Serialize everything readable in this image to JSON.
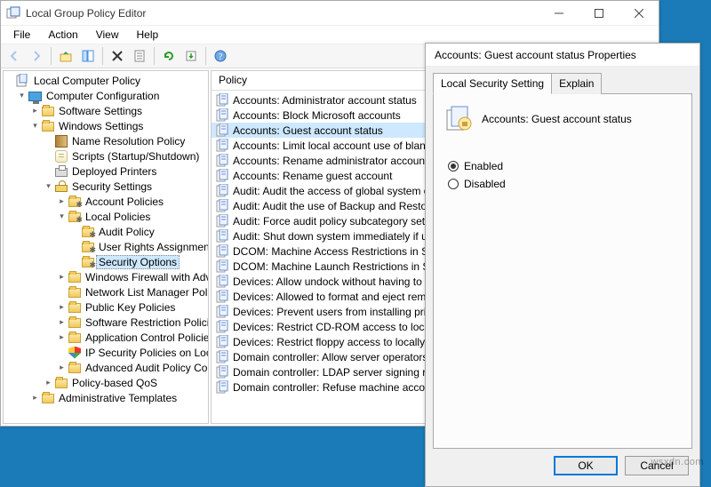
{
  "window": {
    "title": "Local Group Policy Editor"
  },
  "menubar": [
    "File",
    "Action",
    "View",
    "Help"
  ],
  "tree": {
    "root": "Local Computer Policy",
    "cc": "Computer Configuration",
    "ss": "Software Settings",
    "ws": "Windows Settings",
    "nrp": "Name Resolution Policy",
    "sss": "Scripts (Startup/Shutdown)",
    "dp": "Deployed Printers",
    "sec": "Security Settings",
    "ap": "Account Policies",
    "lp": "Local Policies",
    "audit": "Audit Policy",
    "ura": "User Rights Assignment",
    "so": "Security Options",
    "wfwa": "Windows Firewall with Advanced Security",
    "nlmp": "Network List Manager Policies",
    "pkp": "Public Key Policies",
    "srp": "Software Restriction Policies",
    "acp": "Application Control Policies",
    "ipsec": "IP Security Policies on Local Computer",
    "aap": "Advanced Audit Policy Configuration",
    "pqos": "Policy-based QoS",
    "at": "Administrative Templates"
  },
  "list": {
    "header": "Policy",
    "items": [
      "Accounts: Administrator account status",
      "Accounts: Block Microsoft accounts",
      "Accounts: Guest account status",
      "Accounts: Limit local account use of blank passwords to console logon only",
      "Accounts: Rename administrator account",
      "Accounts: Rename guest account",
      "Audit: Audit the access of global system objects",
      "Audit: Audit the use of Backup and Restore privilege",
      "Audit: Force audit policy subcategory settings",
      "Audit: Shut down system immediately if unable to log",
      "DCOM: Machine Access Restrictions in Security Descriptor",
      "DCOM: Machine Launch Restrictions in Security Descriptor",
      "Devices: Allow undock without having to log on",
      "Devices: Allowed to format and eject removable media",
      "Devices: Prevent users from installing printer drivers",
      "Devices: Restrict CD-ROM access to locally logged-on",
      "Devices: Restrict floppy access to locally logged-on",
      "Domain controller: Allow server operators to schedule",
      "Domain controller: LDAP server signing requirements",
      "Domain controller: Refuse machine account password"
    ]
  },
  "dialog": {
    "title": "Accounts: Guest account status Properties",
    "tabs": {
      "t1": "Local Security Setting",
      "t2": "Explain"
    },
    "heading": "Accounts: Guest account status",
    "opt_enabled": "Enabled",
    "opt_disabled": "Disabled",
    "ok": "OK",
    "cancel": "Cancel"
  },
  "watermark": "wsxdn.com"
}
